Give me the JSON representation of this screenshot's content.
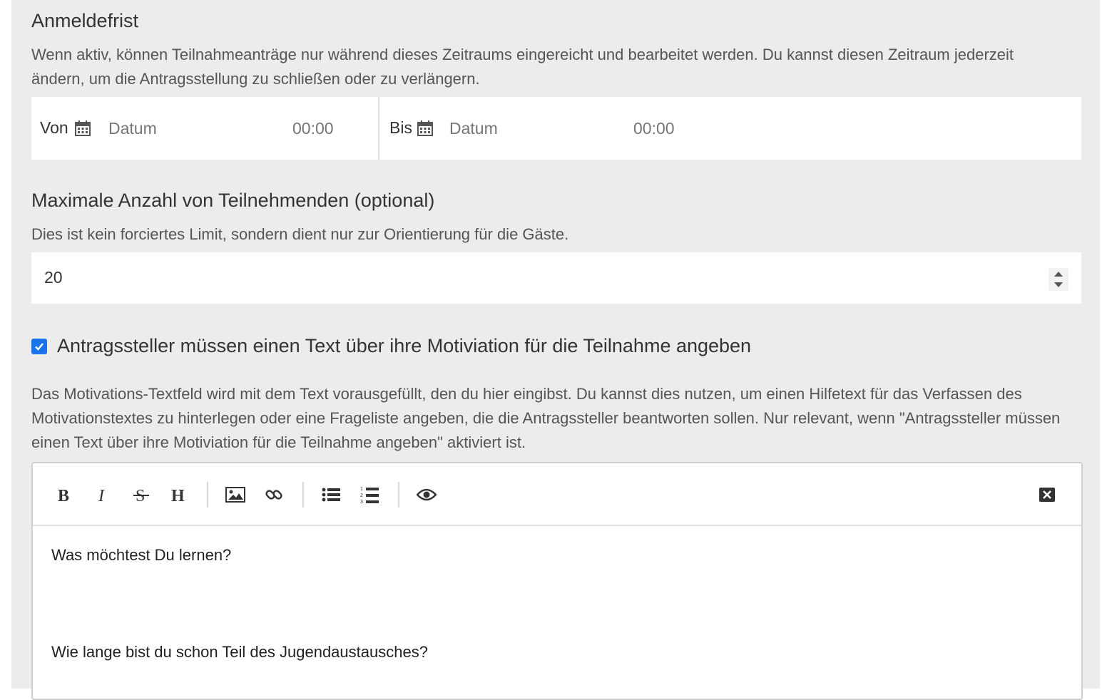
{
  "deadline": {
    "title": "Anmeldefrist",
    "help": "Wenn aktiv, können Teilnahmeanträge nur während dieses Zeitraums eingereicht und bearbeitet werden. Du kannst diesen Zeitraum jederzeit ändern, um die Antragsstellung zu schließen oder zu verlängern.",
    "from_label": "Von",
    "to_label": "Bis",
    "date_placeholder": "Datum",
    "time_placeholder": "00:00"
  },
  "max_participants": {
    "title": "Maximale Anzahl von Teilnehmenden (optional)",
    "help": "Dies ist kein forciertes Limit, sondern dient nur zur Orientierung für die Gäste.",
    "value": "20"
  },
  "motivation": {
    "checkbox_label": "Antragssteller müssen einen Text über ihre Motiviation für die Teilnahme angeben",
    "checked": true,
    "help": "Das Motivations-Textfeld wird mit dem Text vorausgefüllt, den du hier eingibst. Du kannst dies nutzen, um einen Hilfetext für das Verfassen des Motivationstextes zu hinterlegen oder eine Frageliste angeben, die die Antragssteller beantworten sollen. Nur relevant, wenn \"Antragssteller müssen einen Text über ihre Motiviation für die Teilnahme angeben\" aktiviert ist."
  },
  "editor": {
    "toolbar": [
      "bold-icon",
      "italic-icon",
      "strikethrough-icon",
      "heading-icon",
      "image-icon",
      "link-icon",
      "bullet-list-icon",
      "numbered-list-icon",
      "preview-eye-icon",
      "fullscreen-close-icon"
    ],
    "lines": [
      "Was möchtest Du lernen?",
      "Wie lange bist du schon Teil des Jugendaustausches?"
    ]
  },
  "colors": {
    "panel_bg": "#ececec",
    "checkbox_accent": "#1a73e8"
  }
}
